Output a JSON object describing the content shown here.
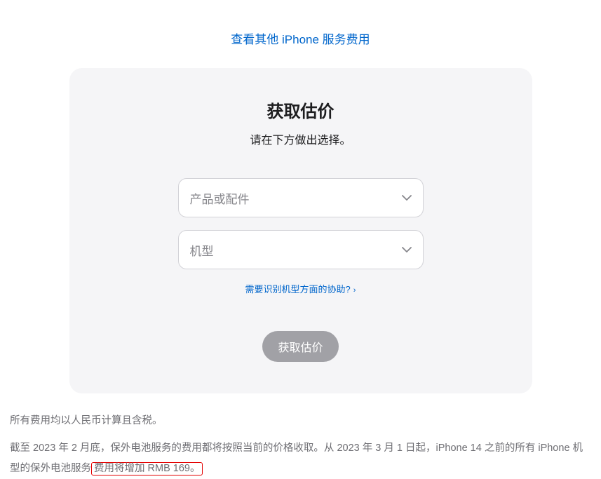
{
  "top_link": "查看其他 iPhone 服务费用",
  "card": {
    "title": "获取估价",
    "subtitle": "请在下方做出选择。",
    "select1_placeholder": "产品或配件",
    "select2_placeholder": "机型",
    "help_link": "需要识别机型方面的协助?",
    "submit_label": "获取估价"
  },
  "footer": {
    "line1": "所有费用均以人民币计算且含税。",
    "line2_part1": "截至 2023 年 2 月底，保外电池服务的费用都将按照当前的价格收取。从 2023 年 3 月 1 日起，iPhone 14 之前的所有 iPhone 机型的保外电池服务",
    "line2_highlight": "费用将增加 RMB 169。"
  }
}
